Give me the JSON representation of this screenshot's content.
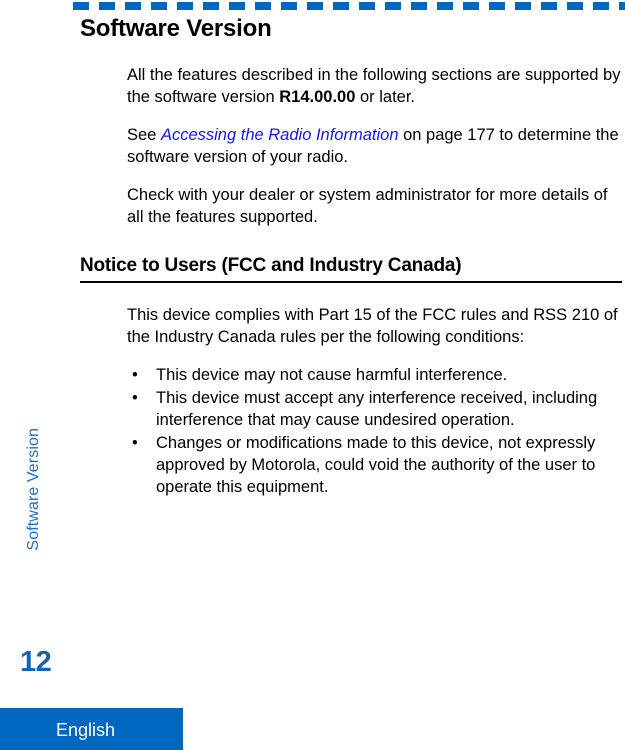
{
  "document": {
    "page_number": "12",
    "language_footer": "English",
    "side_tab_label": "Software Version",
    "accent_color": "#0066c0",
    "link_color": "#1417e8",
    "side_tab_color": "#1a6ec0",
    "page_number_color": "#1464b4"
  },
  "decor": {
    "top_rule_name": "dashed-rule"
  },
  "section": {
    "title": "Software Version",
    "paragraphs": [
      {
        "id": "p1",
        "pre": "All the features described in the following sections are supported by the software version ",
        "bold": "R14.00.00",
        "post": " or later."
      },
      {
        "id": "p2",
        "pre": "See ",
        "link": "Accessing the Radio Information",
        "post": " on page 177 to determine the software version of your radio."
      },
      {
        "id": "p3",
        "text": "Check with your dealer or system administrator for more details of all the features supported."
      }
    ]
  },
  "notice": {
    "heading": "Notice to Users (FCC and Industry Canada)",
    "intro": "This device complies with Part 15 of the FCC rules and RSS 210 of the Industry Canada rules per the following conditions:",
    "bullet_glyph": "•",
    "bullets": [
      "This device may not cause harmful interference.",
      "This device must accept any interference received, including interference that may cause undesired operation.",
      "Changes or modifications made to this device, not expressly approved by Motorola, could void the authority of the user to operate this equipment."
    ]
  }
}
